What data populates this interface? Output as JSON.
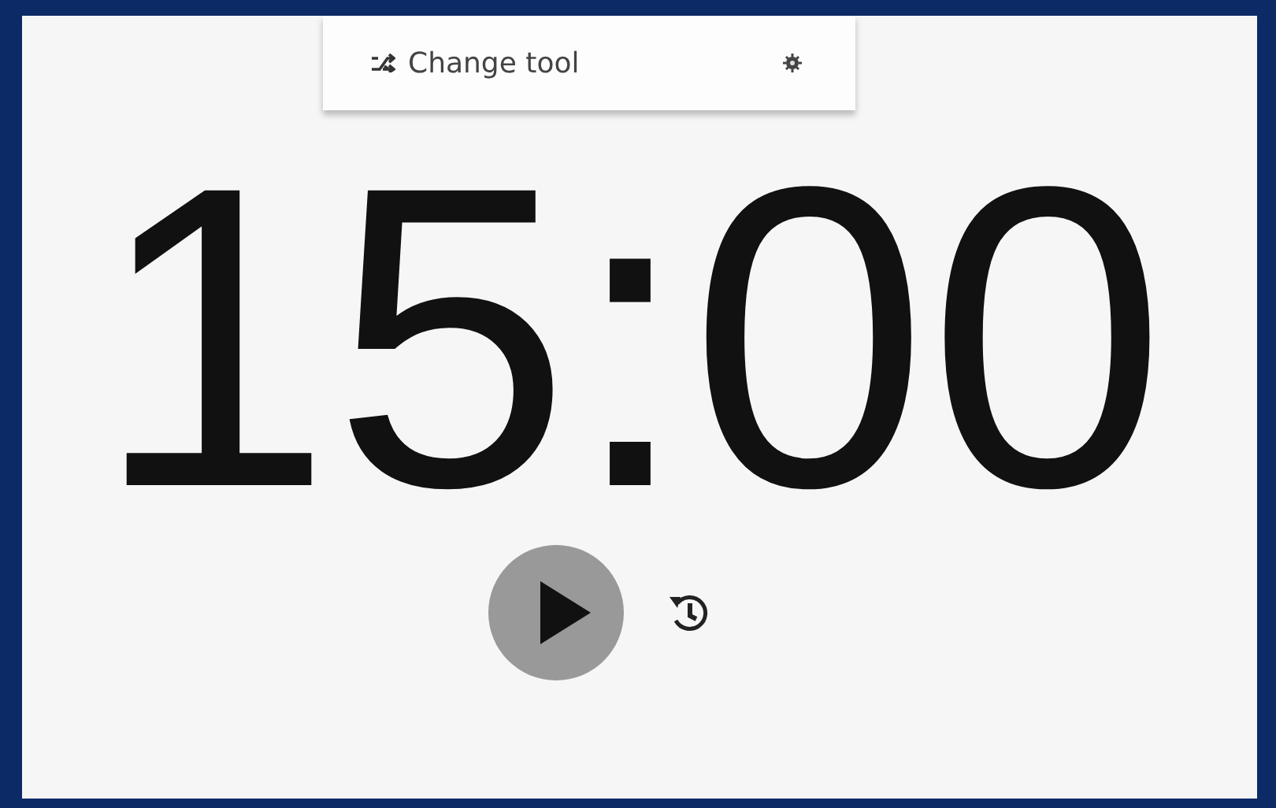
{
  "toolbar": {
    "change_tool": "Change tool"
  },
  "timer": {
    "display": "15:00",
    "running": false
  }
}
